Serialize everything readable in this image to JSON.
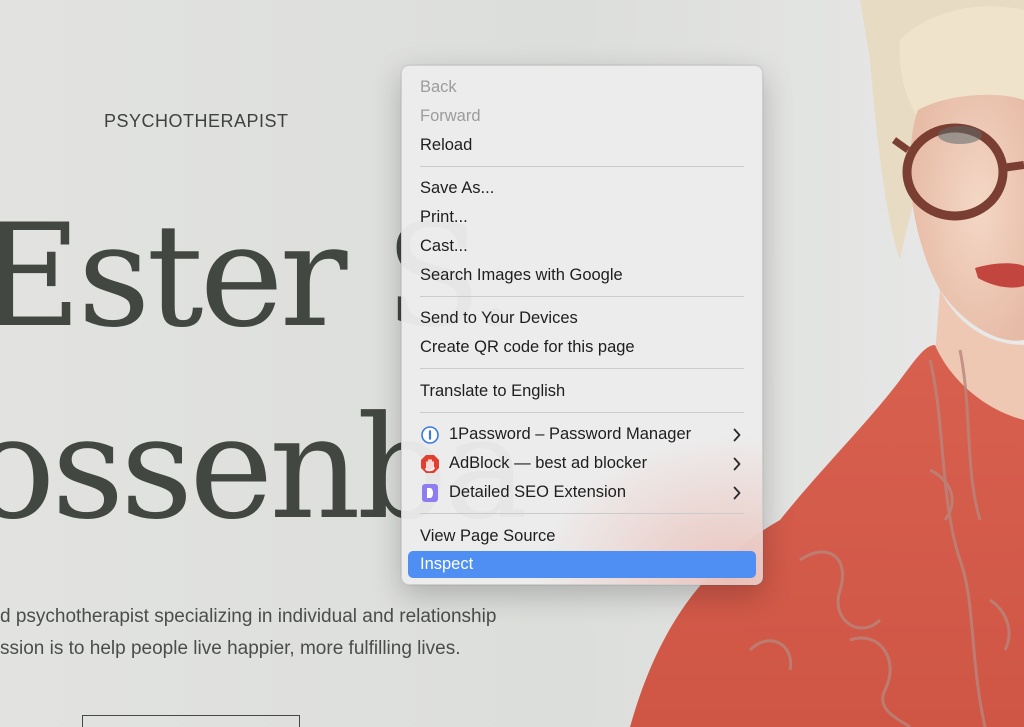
{
  "page": {
    "eyebrow": "PSYCHOTHERAPIST",
    "hero_line_1": "Ester S.",
    "hero_line_2": "ossenba",
    "bio_line_1": "d psychotherapist specializing in individual and relationship",
    "bio_line_2": "ssion is to help people live happier, more fulfilling lives."
  },
  "context_menu": {
    "items": {
      "back": "Back",
      "forward": "Forward",
      "reload": "Reload",
      "save_as": "Save As...",
      "print": "Print...",
      "cast": "Cast...",
      "search_images": "Search Images with Google",
      "send_devices": "Send to Your Devices",
      "qr_code": "Create QR code for this page",
      "translate": "Translate to English",
      "onepassword": "1Password – Password Manager",
      "adblock": "AdBlock — best ad blocker",
      "seo": "Detailed SEO Extension",
      "view_source": "View Page Source",
      "inspect": "Inspect"
    },
    "icons": {
      "onepassword": "1password-icon",
      "adblock": "adblock-hand-icon",
      "seo": "detailed-seo-d-icon",
      "submenu": "chevron-right-icon"
    },
    "colors": {
      "selected_bg": "#4f8ff4",
      "disabled_text": "#9c9c9c",
      "adblock_red": "#e1402e",
      "seo_purple": "#8f7cf0",
      "onepassword_blue": "#3a7be0"
    }
  }
}
